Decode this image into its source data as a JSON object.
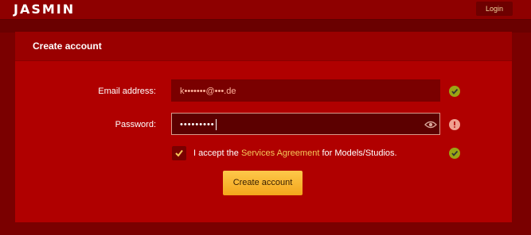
{
  "header": {
    "logo": "JASMIN",
    "login_label": "Login"
  },
  "form": {
    "title": "Create account",
    "email_label": "Email address:",
    "email_value": "k•••••••@•••.de",
    "password_label": "Password:",
    "password_value": "•••••••••",
    "agree_prefix": "I accept the",
    "agree_link": "Services Agreement",
    "agree_suffix": "for Models/Studios.",
    "submit_label": "Create account",
    "email_status": "valid",
    "password_status": "warning",
    "agree_status": "valid",
    "agree_checked": true
  },
  "colors": {
    "background": "#7a0000",
    "panel": "#b00000",
    "accent_button": "#f4a61c",
    "link": "#f5c75a",
    "valid_icon": "#9aa514",
    "warning_icon": "#f0a090"
  },
  "icons": {
    "valid": "checkmark-icon",
    "warning": "info-icon",
    "password_toggle": "eye-icon"
  }
}
